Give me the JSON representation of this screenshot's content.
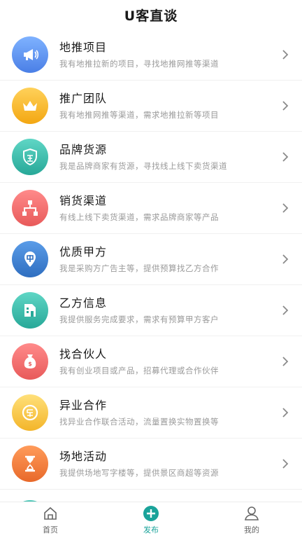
{
  "header": {
    "title": "U客直谈"
  },
  "items": [
    {
      "title": "地推项目",
      "subtitle": "我有地推拉新的项目，寻找地推网推等渠道",
      "icon": "megaphone-icon",
      "color": "#5b8def"
    },
    {
      "title": "推广团队",
      "subtitle": "我有地推网推等渠道，需求地推拉新等项目",
      "icon": "crown-icon",
      "color": "#f6b21e"
    },
    {
      "title": "品牌货源",
      "subtitle": "我是品牌商家有货源，寻找线上线下卖货渠道",
      "icon": "shield-icon",
      "color": "#2fb9a8"
    },
    {
      "title": "销货渠道",
      "subtitle": "有线上线下卖货渠道，需求品牌商家等产品",
      "icon": "network-icon",
      "color": "#f06b6b"
    },
    {
      "title": "优质甲方",
      "subtitle": "我是采购方广告主等，提供预算找乙方合作",
      "icon": "location-pin-icon",
      "color": "#3a7fd0"
    },
    {
      "title": "乙方信息",
      "subtitle": "我提供服务完成要求，需求有预算甲方客户",
      "icon": "building-icon",
      "color": "#2fb9a8"
    },
    {
      "title": "找合伙人",
      "subtitle": "我有创业项目或产品，招募代理或合作伙伴",
      "icon": "money-bag-icon",
      "color": "#f06b6b"
    },
    {
      "title": "异业合作",
      "subtitle": "找异业合作联合活动，流量置换实物置换等",
      "icon": "badge-icon",
      "color": "#f6c03b"
    },
    {
      "title": "场地活动",
      "subtitle": "我提供场地写字楼等，提供景区商超等资源",
      "icon": "hourglass-icon",
      "color": "#f07a3e"
    }
  ],
  "tabbar": {
    "tabs": [
      {
        "label": "首页",
        "icon": "home-icon"
      },
      {
        "label": "发布",
        "icon": "plus-circle-icon"
      },
      {
        "label": "我的",
        "icon": "user-icon"
      }
    ],
    "active_color": "#1aa39a"
  }
}
